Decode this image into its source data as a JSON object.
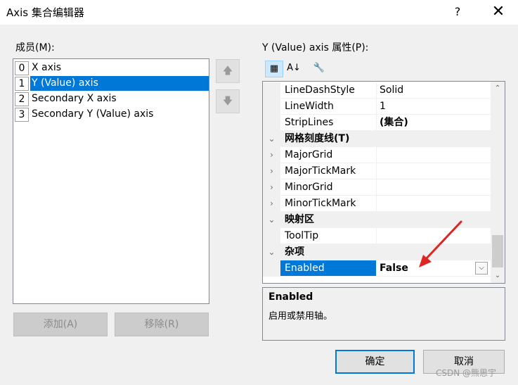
{
  "window": {
    "title": "Axis 集合编辑器",
    "help": "?",
    "close": "✕"
  },
  "members": {
    "label": "成员(M):",
    "items": [
      {
        "index": "0",
        "name": "X axis"
      },
      {
        "index": "1",
        "name": "Y (Value) axis",
        "selected": true
      },
      {
        "index": "2",
        "name": "Secondary X axis"
      },
      {
        "index": "3",
        "name": "Secondary Y (Value) axis"
      }
    ],
    "move_up": "🡅",
    "move_down": "🡇",
    "add_label": "添加(A)",
    "remove_label": "移除(R)"
  },
  "properties": {
    "label": "Y (Value) axis 属性(P):",
    "toolbar": {
      "categorized": "▦",
      "alphabetical": "A↓",
      "pages": "🔧"
    },
    "rows": [
      {
        "type": "prop",
        "name": "LineDashStyle",
        "value": "Solid"
      },
      {
        "type": "prop",
        "name": "LineWidth",
        "value": "1"
      },
      {
        "type": "prop",
        "name": "StripLines",
        "value": "(集合)",
        "value_bold": true
      },
      {
        "type": "cat",
        "name": "网格刻度线(T)"
      },
      {
        "type": "prop",
        "name": "MajorGrid",
        "value": "",
        "expander": "›"
      },
      {
        "type": "prop",
        "name": "MajorTickMark",
        "value": "",
        "expander": "›"
      },
      {
        "type": "prop",
        "name": "MinorGrid",
        "value": "",
        "expander": "›"
      },
      {
        "type": "prop",
        "name": "MinorTickMark",
        "value": "",
        "expander": "›"
      },
      {
        "type": "cat",
        "name": "映射区"
      },
      {
        "type": "prop",
        "name": "ToolTip",
        "value": ""
      },
      {
        "type": "cat",
        "name": "杂项",
        "expander": "⌄"
      },
      {
        "type": "prop",
        "name": "Enabled",
        "value": "False",
        "selected": true
      }
    ],
    "description": {
      "title": "Enabled",
      "text": "启用或禁用轴。"
    }
  },
  "buttons": {
    "ok": "确定",
    "cancel": "取消"
  },
  "watermark": "CSDN @熊思宇",
  "colors": {
    "selection": "#0078d7",
    "arrow": "#e02424"
  }
}
